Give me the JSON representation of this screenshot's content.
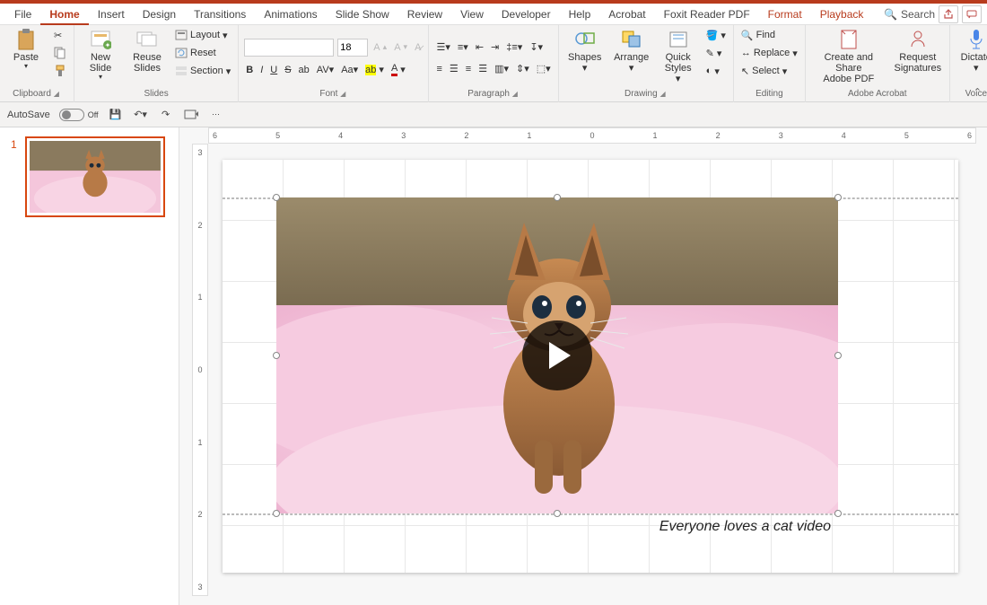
{
  "tabs": {
    "file": "File",
    "home": "Home",
    "insert": "Insert",
    "design": "Design",
    "transitions": "Transitions",
    "animations": "Animations",
    "slideshow": "Slide Show",
    "review": "Review",
    "view": "View",
    "developer": "Developer",
    "help": "Help",
    "acrobat": "Acrobat",
    "foxit": "Foxit Reader PDF",
    "format": "Format",
    "playback": "Playback",
    "search": "Search"
  },
  "ribbon": {
    "clipboard": {
      "label": "Clipboard",
      "paste": "Paste"
    },
    "slides": {
      "label": "Slides",
      "new": "New\nSlide",
      "reuse": "Reuse\nSlides",
      "layout": "Layout",
      "reset": "Reset",
      "section": "Section"
    },
    "font": {
      "label": "Font",
      "name": "",
      "size": "18"
    },
    "paragraph": {
      "label": "Paragraph"
    },
    "drawing": {
      "label": "Drawing",
      "shapes": "Shapes",
      "arrange": "Arrange",
      "quick": "Quick\nStyles"
    },
    "editing": {
      "label": "Editing",
      "find": "Find",
      "replace": "Replace",
      "select": "Select"
    },
    "acrobat": {
      "label": "Adobe Acrobat",
      "create": "Create and Share\nAdobe PDF",
      "request": "Request\nSignatures"
    },
    "voice": {
      "label": "Voice",
      "dictate": "Dictate"
    }
  },
  "qat": {
    "autosave": "AutoSave",
    "off": "Off"
  },
  "thumb": {
    "num": "1"
  },
  "caption": "Everyone loves a cat video",
  "hruler_ticks": [
    "6",
    "5",
    "4",
    "3",
    "2",
    "1",
    "0",
    "1",
    "2",
    "3",
    "4",
    "5",
    "6"
  ],
  "vruler_ticks": [
    "3",
    "2",
    "1",
    "0",
    "1",
    "2",
    "3"
  ]
}
